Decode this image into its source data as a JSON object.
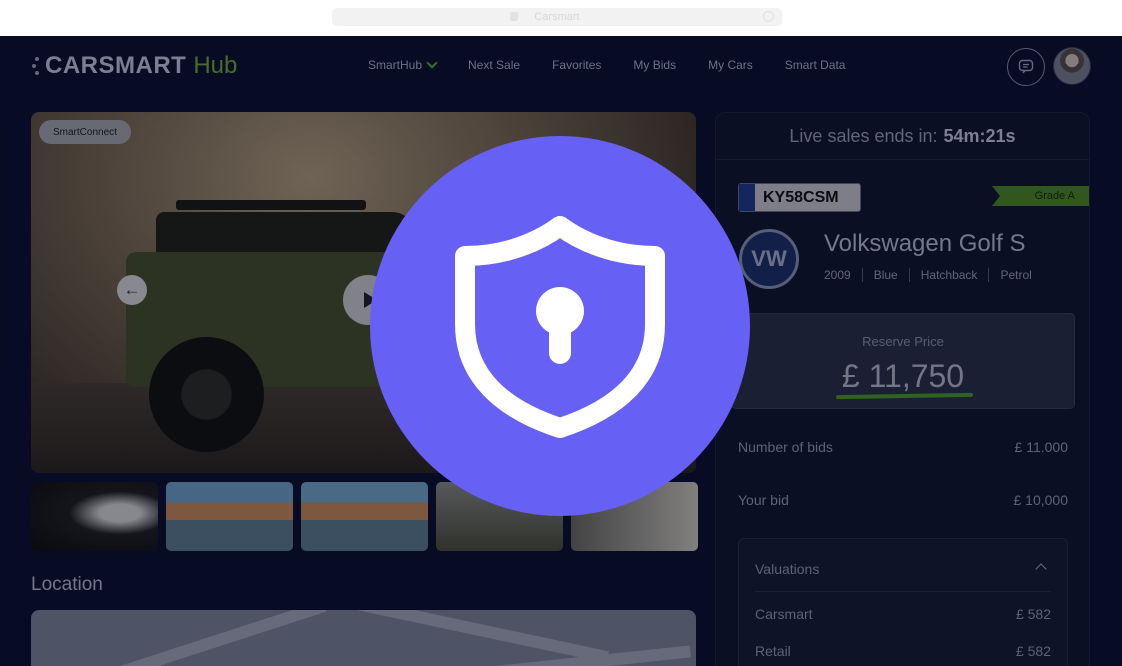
{
  "browser": {
    "url_title": "Carsmart"
  },
  "header": {
    "logo_text": "CARSMART",
    "logo_sub": "Hub",
    "nav": [
      "SmartHub",
      "Next Sale",
      "Favorites",
      "My Bids",
      "My Cars",
      "Smart Data"
    ]
  },
  "gallery": {
    "badge": "SmartConnect",
    "prev_icon": "arrow-left-icon",
    "play_icon": "play-icon"
  },
  "location": {
    "title": "Location"
  },
  "panel": {
    "timer_label": "Live sales ends in:",
    "timer_value": "54m:21s",
    "plate": "KY58CSM",
    "grade": "Grade A",
    "brand_logo": "VW",
    "model": "Volkswagen Golf S",
    "specs": [
      "2009",
      "Blue",
      "Hatchback",
      "Petrol"
    ],
    "reserve_label": "Reserve Price",
    "reserve_value": "£ 11,750",
    "bids_label": "Number of bids",
    "bids_value": "£ 11.000",
    "your_bid_label": "Your bid",
    "your_bid_value": "£ 10,000",
    "valuations_title": "Valuations",
    "valuations": [
      {
        "label": "Carsmart",
        "value": "£ 582"
      },
      {
        "label": "Retail",
        "value": "£ 582"
      }
    ]
  },
  "overlay": {
    "icon": "shield-keyhole-icon",
    "color": "#6660f5"
  },
  "colors": {
    "background": "#0a0f2e",
    "accent_green": "#4f8a24",
    "text_muted": "#959bb0"
  }
}
